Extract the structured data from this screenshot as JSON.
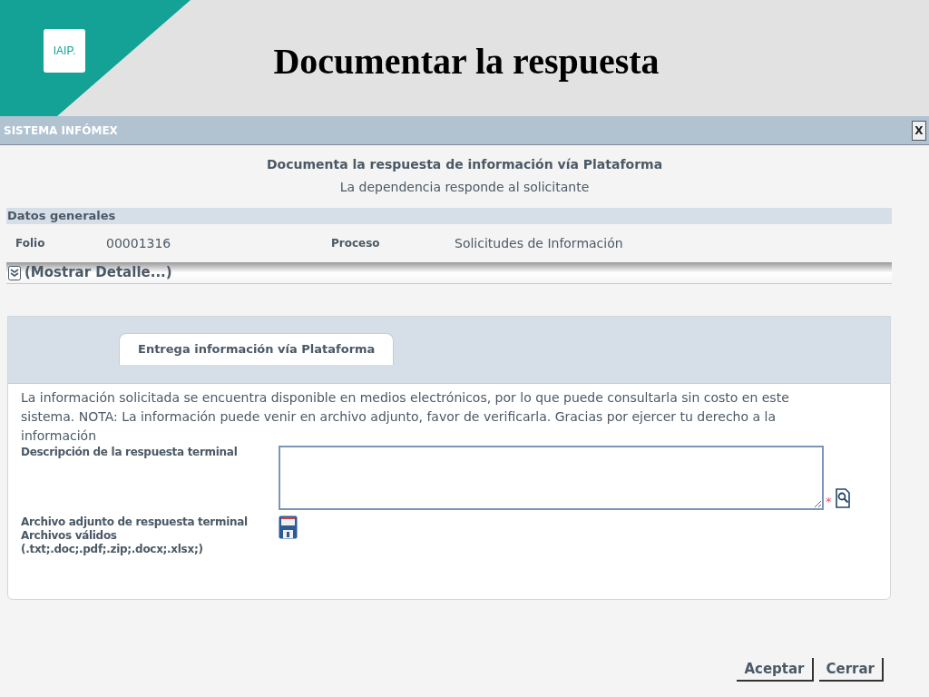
{
  "slide": {
    "logo": "IAIP.",
    "title": "Documentar la respuesta"
  },
  "window": {
    "title": "SISTEMA INFÓMEX",
    "close": "X"
  },
  "header": {
    "title": "Documenta la respuesta de información vía Plataforma",
    "subtitle": "La dependencia responde al solicitante"
  },
  "general": {
    "heading": "Datos generales",
    "fields": [
      {
        "label": "Folio",
        "value": "00001316"
      },
      {
        "label": "Proceso",
        "value": "Solicitudes de Información"
      }
    ],
    "details_toggle": {
      "label": "(Mostrar Detalle...)",
      "expanded": false
    }
  },
  "tabs": [
    {
      "label": "Entrega información vía Plataforma",
      "selected": true
    }
  ],
  "panel": {
    "notice": "La información solicitada se encuentra disponible en medios electrónicos, por lo que puede consultarla sin costo en este sistema. NOTA: La información puede venir en archivo adjunto, favor de verificarla. Gracias por ejercer tu derecho a la información",
    "fields": [
      {
        "kind": "textarea",
        "label_lines": [
          "Descripción de la respuesta terminal"
        ],
        "required_mark": "*"
      },
      {
        "kind": "file",
        "label_lines": [
          "Archivo adjunto de respuesta terminal",
          "Archivos válidos",
          "(.txt;.doc;.pdf;.zip;.docx;.xlsx;)"
        ]
      }
    ]
  },
  "buttons": [
    "Aceptar",
    "Cerrar"
  ]
}
